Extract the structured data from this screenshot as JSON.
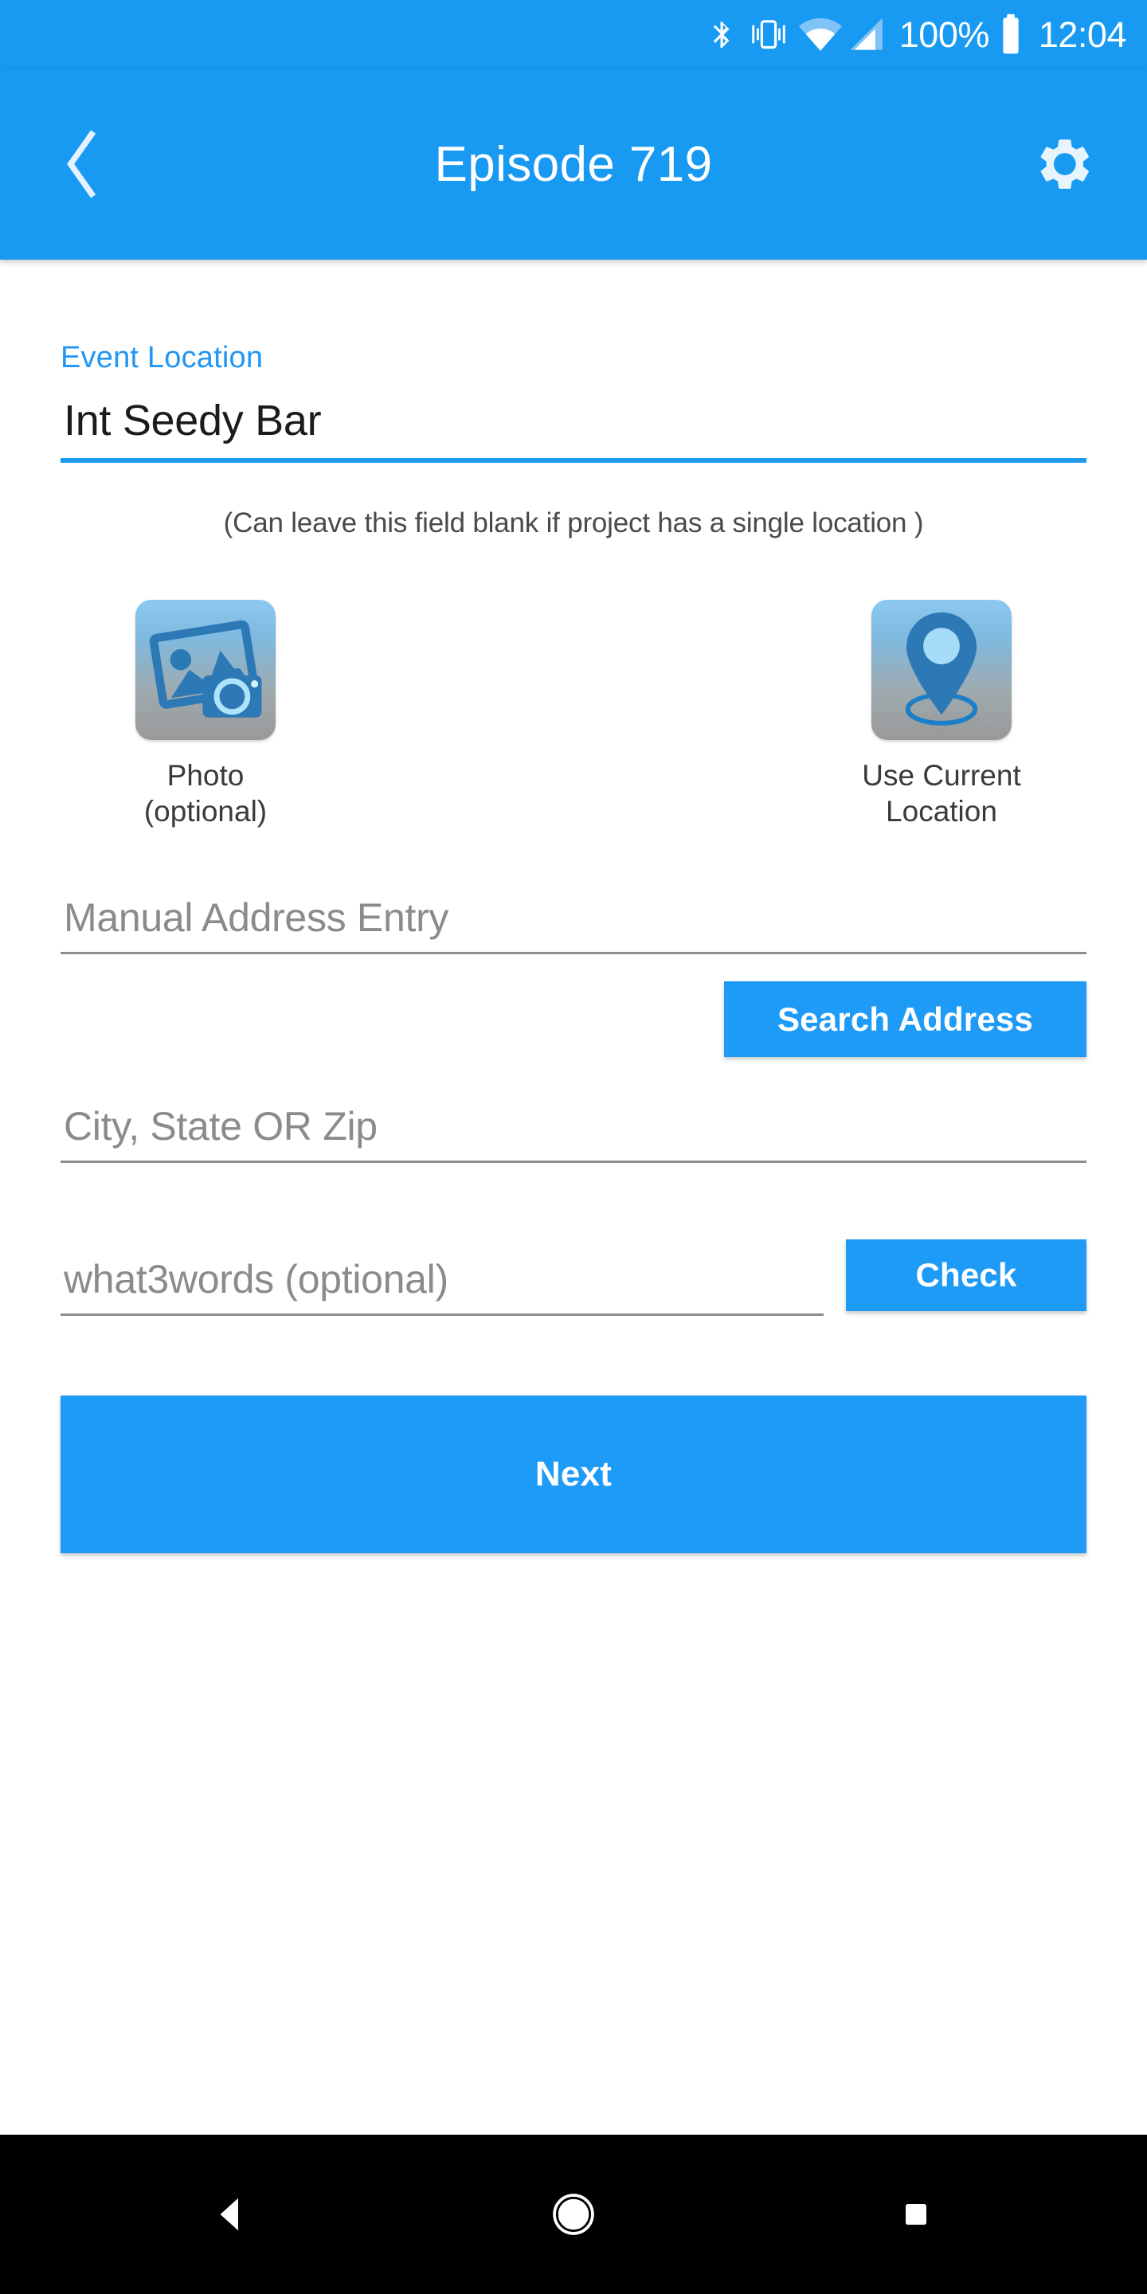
{
  "status_bar": {
    "icons": [
      "bluetooth-icon",
      "vibrate-icon",
      "wifi-icon",
      "cell-signal-icon",
      "battery-icon"
    ],
    "battery_percent": "100%",
    "time": "12:04"
  },
  "app_bar": {
    "back_icon": "back-chevron-icon",
    "title": "Episode 719",
    "settings_icon": "gear-icon"
  },
  "form": {
    "event_location_label": "Event Location",
    "event_location_value": "Int Seedy Bar",
    "hint": "(Can leave this field blank if project has a single location )",
    "manual_address_placeholder": "Manual Address Entry",
    "manual_address_value": "",
    "search_address_label": "Search Address",
    "city_state_zip_placeholder": "City, State OR Zip",
    "city_state_zip_value": "",
    "what3words_placeholder": "what3words (optional)",
    "what3words_value": "",
    "check_label": "Check",
    "next_label": "Next"
  },
  "actions": [
    {
      "icon": "photo-camera-icon",
      "caption_line1": "Photo",
      "caption_line2": "(optional)"
    },
    {
      "icon": "map-pin-icon",
      "caption_line1": "Use Current",
      "caption_line2": "Location"
    }
  ],
  "nav_bar": {
    "back_icon": "nav-back-triangle-icon",
    "home_icon": "nav-home-circle-icon",
    "recents_icon": "nav-recents-square-icon"
  },
  "colors": {
    "primary_blue": "#1899F2",
    "accent_blue": "#1E9BF7",
    "label_blue": "#2196F3",
    "underline_gray": "#8d8d8d",
    "nav_background": "#000000"
  }
}
